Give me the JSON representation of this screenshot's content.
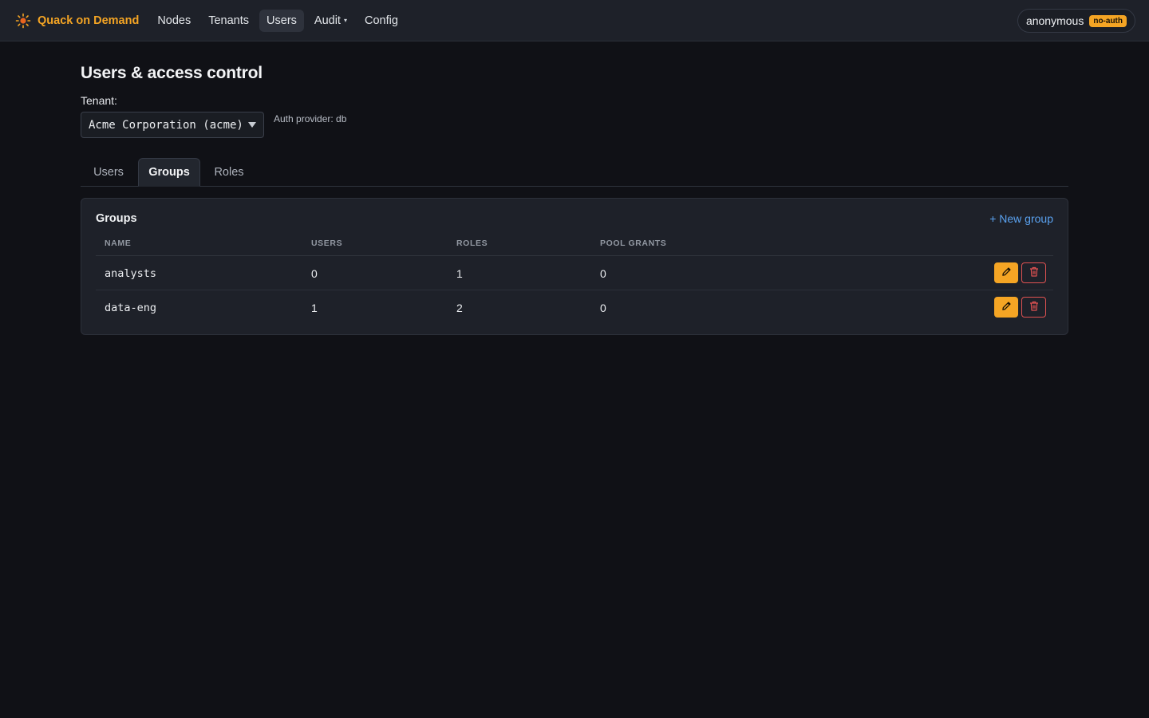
{
  "nav": {
    "brand": "Quack on Demand",
    "brand_color": "#f5a524",
    "links": [
      {
        "label": "Nodes"
      },
      {
        "label": "Tenants"
      },
      {
        "label": "Users"
      },
      {
        "label": "Audit"
      },
      {
        "label": "Config"
      }
    ],
    "active_link": "Users",
    "audit_caret": "▾",
    "user": {
      "name": "anonymous",
      "badge": "no-auth"
    }
  },
  "page": {
    "title": "Users & access control",
    "tenant_label": "Tenant:",
    "tenant_value": "Acme Corporation (acme)",
    "auth_provider": "Auth provider: db"
  },
  "tabs": [
    {
      "label": "Users"
    },
    {
      "label": "Groups"
    },
    {
      "label": "Roles"
    }
  ],
  "active_tab": "Groups",
  "groups_card": {
    "title": "Groups",
    "new_button": "+ New group",
    "columns": [
      "NAME",
      "USERS",
      "ROLES",
      "POOL GRANTS"
    ],
    "rows": [
      {
        "name": "analysts",
        "users": "0",
        "roles": "1",
        "pool_grants": "0"
      },
      {
        "name": "data-eng",
        "users": "1",
        "roles": "2",
        "pool_grants": "0"
      }
    ],
    "edit_icon": "pencil-icon",
    "delete_icon": "trash-icon",
    "accent": "#f5a524",
    "danger": "#e05252",
    "link_color": "#5aa2f0"
  }
}
